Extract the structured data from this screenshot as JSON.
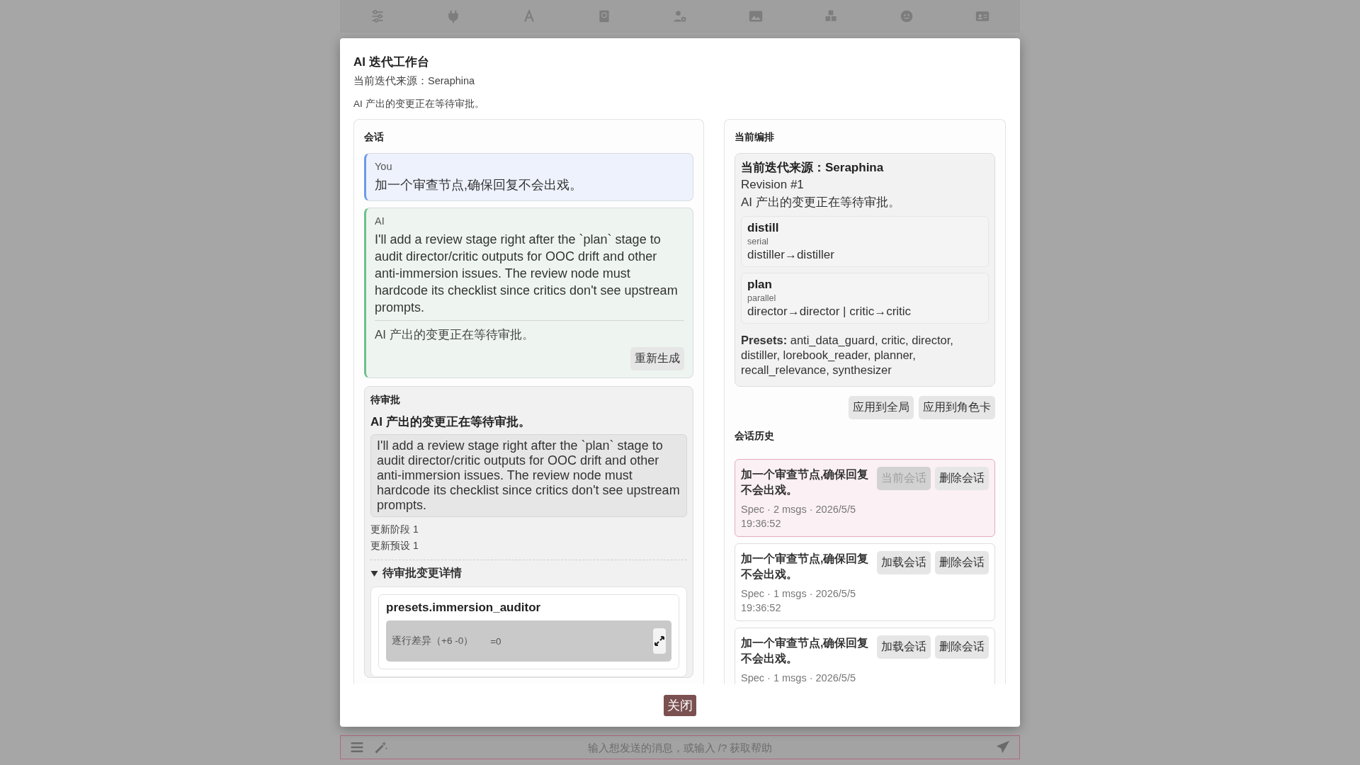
{
  "dialog": {
    "title": "AI 迭代工作台",
    "source": "当前迭代来源：Seraphina",
    "status": "AI 产出的变更正在等待审批。",
    "conversation": {
      "heading": "会话",
      "messages": [
        {
          "kind": "user",
          "author": "You",
          "text": "加一个审查节点,确保回复不会出戏。"
        },
        {
          "kind": "ai",
          "author": "AI",
          "text": "I'll add a review stage right after the `plan` stage to audit director/critic outputs for OOC drift and other anti-immersion issues. The review node must hardcode its checklist since critics don't see upstream prompts.",
          "status": "AI 产出的变更正在等待审批。",
          "action": "重新生成"
        }
      ],
      "pending": {
        "heading": "待审批",
        "title": "AI 产出的变更正在等待审批。",
        "summary": "I'll add a review stage right after the `plan` stage to audit director/critic outputs for OOC drift and other anti-immersion issues. The review node must hardcode its checklist since critics don't see upstream prompts.",
        "stats": [
          "更新阶段 1",
          "更新预设 1"
        ],
        "details": {
          "label": "待审批变更详情",
          "expanded": true,
          "items": [
            {
              "name": "presets.immersion_auditor",
              "diff": "逐行差异（+6 -0）",
              "unchanged": "=0"
            }
          ]
        }
      }
    },
    "arrangement": {
      "heading": "当前编排",
      "source": "当前迭代来源：Seraphina",
      "revision": "Revision #1",
      "status": "AI 产出的变更正在等待审批。",
      "stages": [
        {
          "name": "distill",
          "mode": "serial",
          "flow": "distiller→distiller"
        },
        {
          "name": "plan",
          "mode": "parallel",
          "flow": "director→director | critic→critic"
        }
      ],
      "presets": "**Presets:** anti_data_guard, critic, director, distiller, lorebook_reader, planner, recall_relevance, synthesizer"
    },
    "apply_buttons": [
      "应用到全局",
      "应用到角色卡"
    ],
    "history": {
      "heading": "会话历史",
      "sessions": [
        {
          "title": "加一个审查节点,确保回复不会出戏。",
          "meta": "Spec · 2 msgs · 2026/5/5 19:36:52",
          "selected": true,
          "primary": "当前会话",
          "delete": "删除会话"
        },
        {
          "title": "加一个审查节点,确保回复不会出戏。",
          "meta": "Spec · 1 msgs · 2026/5/5 19:36:52",
          "selected": false,
          "primary": "加载会话",
          "delete": "删除会话"
        },
        {
          "title": "加一个审查节点,确保回复不会出戏。",
          "meta": "Spec · 1 msgs · 2026/5/5",
          "selected": false,
          "primary": "加载会话",
          "delete": "删除会话"
        }
      ]
    },
    "close": "关闭"
  },
  "composer": {
    "placeholder": "输入想发送的消息，或输入 /? 获取帮助"
  }
}
